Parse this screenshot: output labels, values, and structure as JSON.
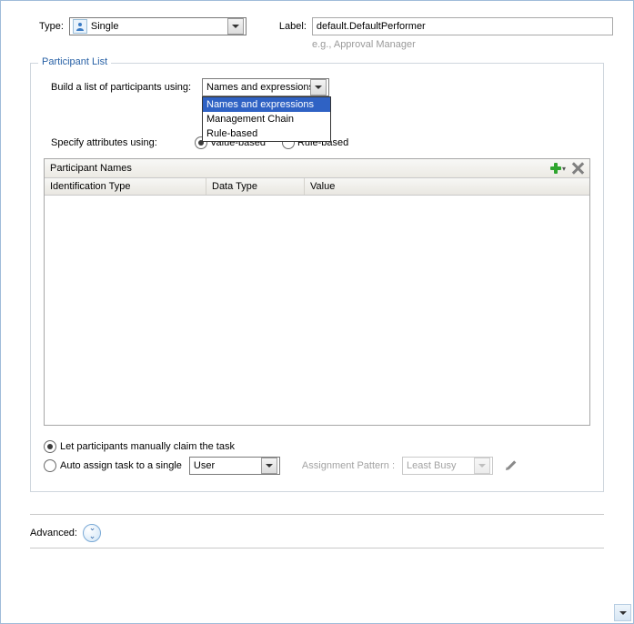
{
  "top": {
    "type_label": "Type:",
    "type_value": "Single",
    "label_label": "Label:",
    "label_value": "default.DefaultPerformer",
    "hint": "e.g., Approval Manager"
  },
  "fieldset": {
    "legend": "Participant List",
    "build_label": "Build a list of participants using:",
    "build_value": "Names and expressions",
    "build_options": {
      "o0": "Names and expressions",
      "o1": "Management Chain",
      "o2": "Rule-based"
    },
    "attr_label": "Specify attributes using:",
    "attr_opt1": "Value-based",
    "attr_opt2": "Rule-based",
    "table_title": "Participant Names",
    "col0": "Identification Type",
    "col1": "Data Type",
    "col2": "Value",
    "assign_opt1": "Let participants manually claim the task",
    "assign_opt2": "Auto assign task to a single",
    "user_value": "User",
    "pattern_label": "Assignment Pattern :",
    "pattern_value": "Least Busy"
  },
  "advanced_label": "Advanced:"
}
